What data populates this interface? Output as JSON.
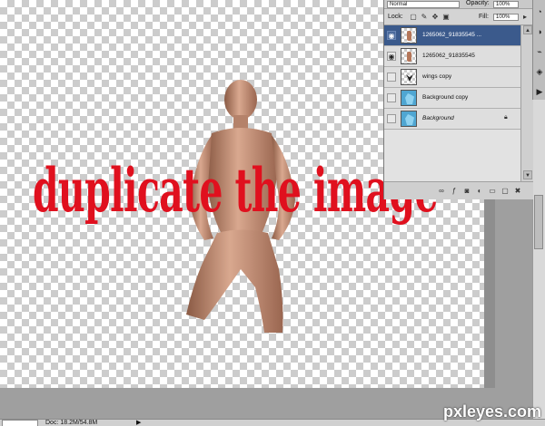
{
  "canvas": {
    "overlay_text": "duplicate the image",
    "overlay_color": "#e0101e",
    "figure_icon": "mannequin-figure"
  },
  "layers_panel": {
    "blend_mode": "Normal",
    "opacity_label": "Opacity:",
    "opacity_value": "100%",
    "lock_label": "Lock:",
    "fill_label": "Fill:",
    "fill_value": "100%",
    "layers": [
      {
        "name": "1265062_91835545 ...",
        "visible": true,
        "active": true,
        "thumb": "figure",
        "italic": false,
        "locked": false
      },
      {
        "name": "1265062_91835545",
        "visible": true,
        "active": false,
        "thumb": "figure",
        "italic": false,
        "locked": false
      },
      {
        "name": "wings copy",
        "visible": false,
        "active": false,
        "thumb": "wings",
        "italic": false,
        "locked": false
      },
      {
        "name": "Background copy",
        "visible": false,
        "active": false,
        "thumb": "hand",
        "italic": false,
        "locked": false
      },
      {
        "name": "Background",
        "visible": false,
        "active": false,
        "thumb": "hand",
        "italic": true,
        "locked": true
      }
    ],
    "bottom_tools": [
      "link-icon",
      "fx-icon",
      "mask-icon",
      "adjustment-icon",
      "group-icon",
      "new-layer-icon",
      "trash-icon"
    ],
    "active_color": "#3b5a8c"
  },
  "status_bar": {
    "doc_info": "Doc: 18.2M/54.8M",
    "arrow": "▶"
  },
  "watermark": "pxleyes.com"
}
